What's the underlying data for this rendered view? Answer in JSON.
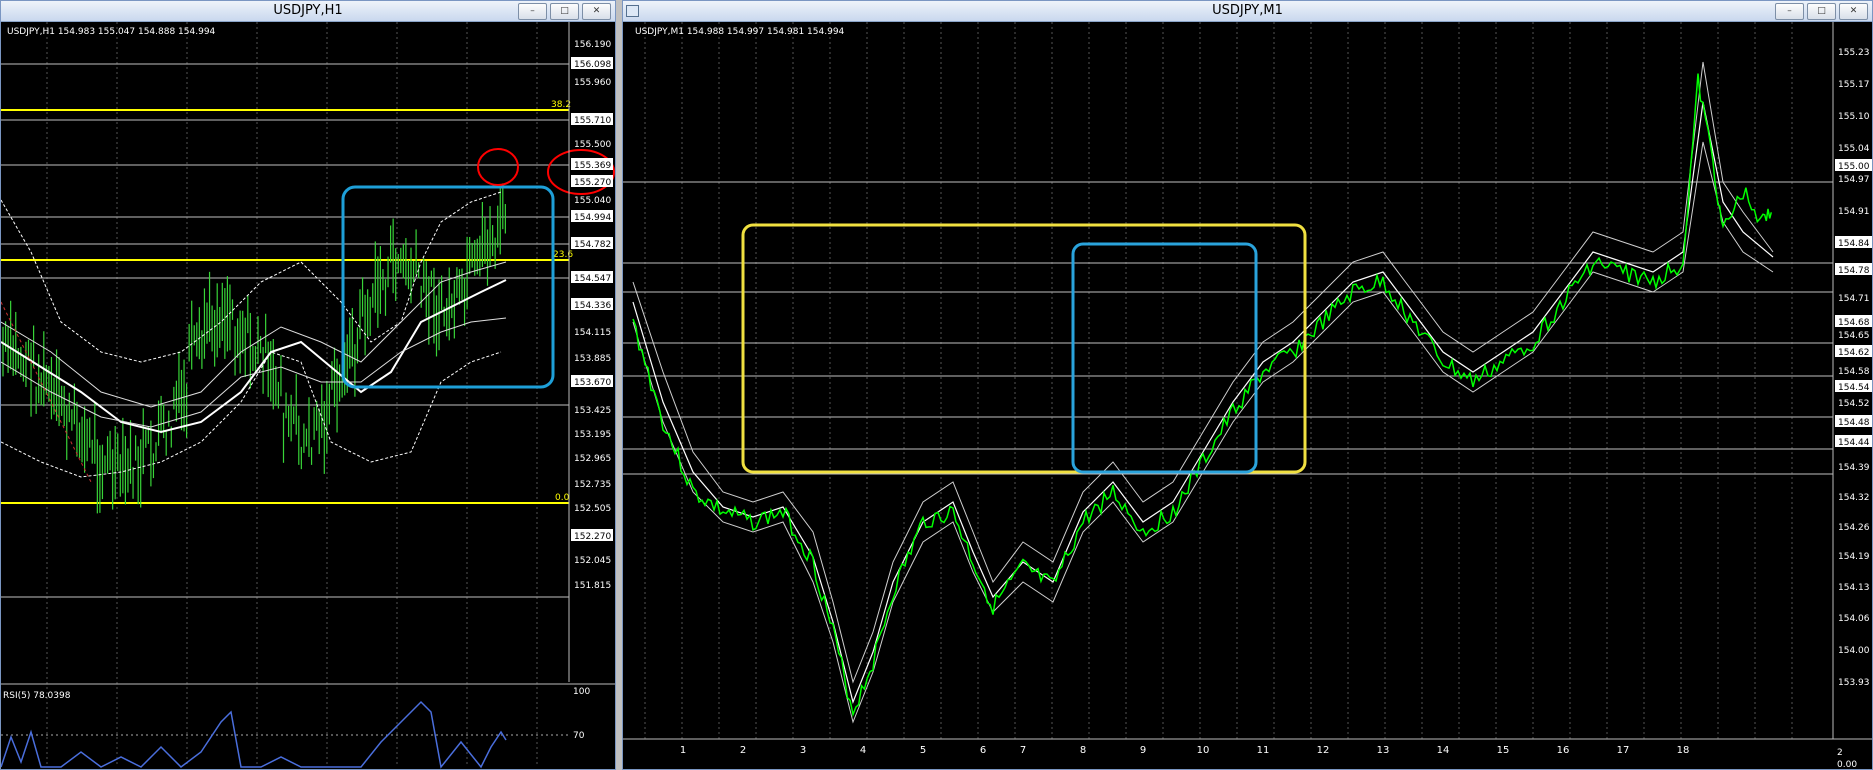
{
  "left_window": {
    "title": "USDJPY,H1",
    "info": "USDJPY,H1  154.983 155.047 154.888 154.994",
    "price_labels": [
      "156.190",
      "156.098",
      "155.960",
      "155.710",
      "155.500",
      "155.369",
      "155.270",
      "155.040",
      "154.994",
      "154.782",
      "154.547",
      "154.336",
      "154.115",
      "153.885",
      "153.670",
      "153.425",
      "153.195",
      "152.965",
      "152.735",
      "152.505",
      "152.270",
      "152.045",
      "151.815"
    ],
    "fib_labels": [
      "38.2",
      "23.6",
      "0.0"
    ],
    "rsi_label": "RSI(5) 78.0398",
    "rsi_levels": [
      "100",
      "70"
    ],
    "controls": [
      "min",
      "max",
      "close"
    ],
    "colors": {
      "candle": "#38d438",
      "fib": "#ffff00",
      "box": "#1e9fd8",
      "circle": "#ff0000",
      "rsi": "#4a6edc"
    }
  },
  "right_window": {
    "title": "USDJPY,M1",
    "info": "USDJPY,M1  154.988 154.997 154.981 154.994",
    "price_labels": [
      "155.23",
      "155.17",
      "155.10",
      "155.04",
      "155.00",
      "154.97",
      "154.91",
      "154.84",
      "154.78",
      "154.71",
      "154.68",
      "154.65",
      "154.62",
      "154.58",
      "154.54",
      "154.52",
      "154.48",
      "154.44",
      "154.39",
      "154.32",
      "154.26",
      "154.19",
      "154.13",
      "154.06",
      "154.00",
      "153.93"
    ],
    "time_labels": [
      "1",
      "2",
      "3",
      "4",
      "5",
      "6",
      "7",
      "8",
      "9",
      "10",
      "11",
      "12",
      "13",
      "14",
      "15",
      "16",
      "17",
      "18"
    ],
    "sub_labels": [
      "2",
      "0.00"
    ],
    "controls": [
      "min",
      "max",
      "close"
    ],
    "colors": {
      "line": "#00ff00",
      "box_yellow": "#f0e040",
      "box_blue": "#2aa3dc"
    }
  }
}
